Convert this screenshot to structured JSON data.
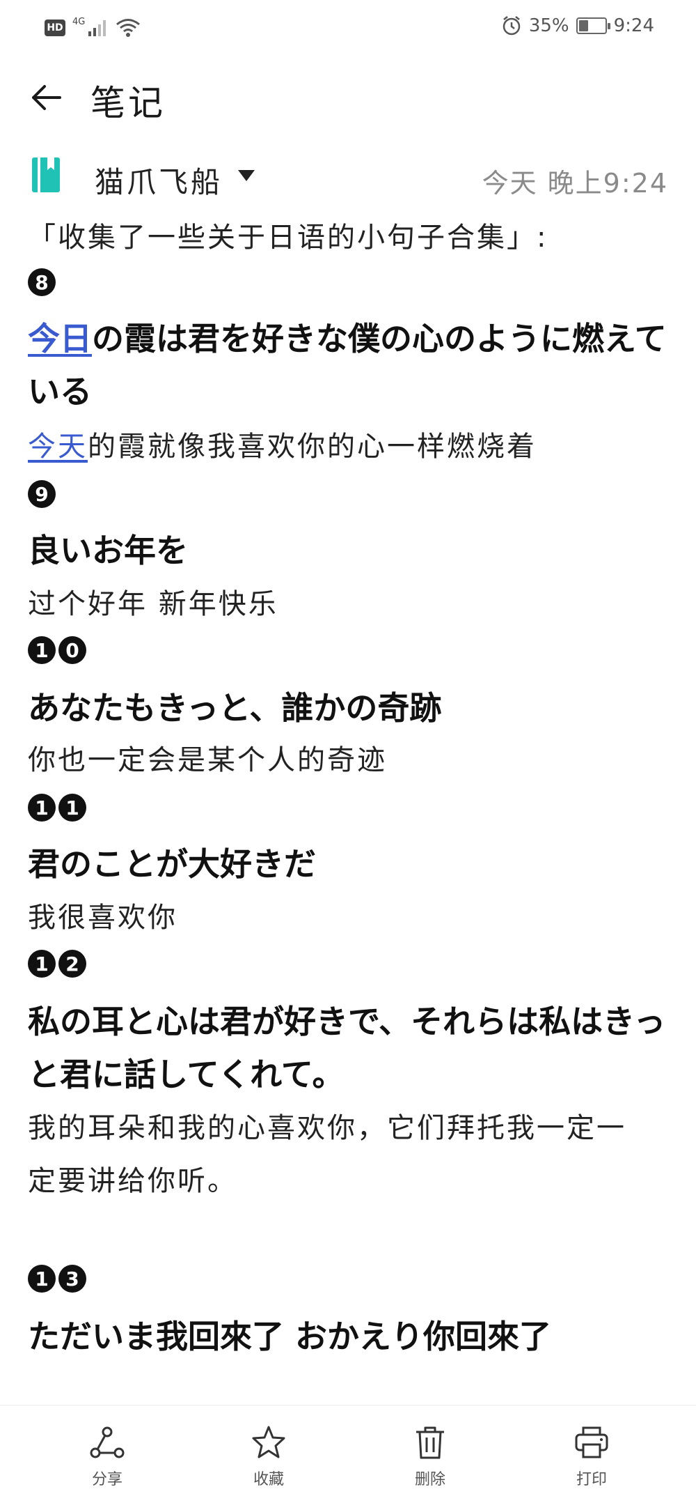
{
  "status_bar": {
    "hd": "HD",
    "network": "4G",
    "battery_percent": "35%",
    "battery_level": 0.35,
    "time": "9:24"
  },
  "header": {
    "title": "笔记"
  },
  "meta": {
    "folder": "猫爪飞船",
    "date": "今天 晚上9:24"
  },
  "note": {
    "intro": "「收集了一些关于日语的小句子合集」:",
    "entries": [
      {
        "num": [
          "8"
        ],
        "jp_link": "今日",
        "jp_rest": "の霞は君を好きな僕の心のように燃えて",
        "jp_wrap": "いる",
        "cn_link": "今天",
        "cn_rest": "的霞就像我喜欢你的心一样燃烧着"
      },
      {
        "num": [
          "9"
        ],
        "jp": "良いお年を",
        "cn": "过个好年 新年快乐"
      },
      {
        "num": [
          "1",
          "0"
        ],
        "jp": "あなたもきっと、誰かの奇跡",
        "cn": "你也一定会是某个人的奇迹"
      },
      {
        "num": [
          "1",
          "1"
        ],
        "jp": "君のことが大好きだ",
        "cn": "我很喜欢你"
      },
      {
        "num": [
          "1",
          "2"
        ],
        "jp": "私の耳と心は君が好きで、それらは私はきっ",
        "jp_wrap": "と君に話してくれて。",
        "cn": "我的耳朵和我的心喜欢你，它们拜托我一定一",
        "cn_wrap": "定要讲给你听。"
      },
      {
        "num": [
          "1",
          "3"
        ],
        "jp": "ただいま我回來了 おかえり你回來了"
      }
    ]
  },
  "toolbar": {
    "share": "分享",
    "favorite": "收藏",
    "delete": "删除",
    "print": "打印"
  }
}
